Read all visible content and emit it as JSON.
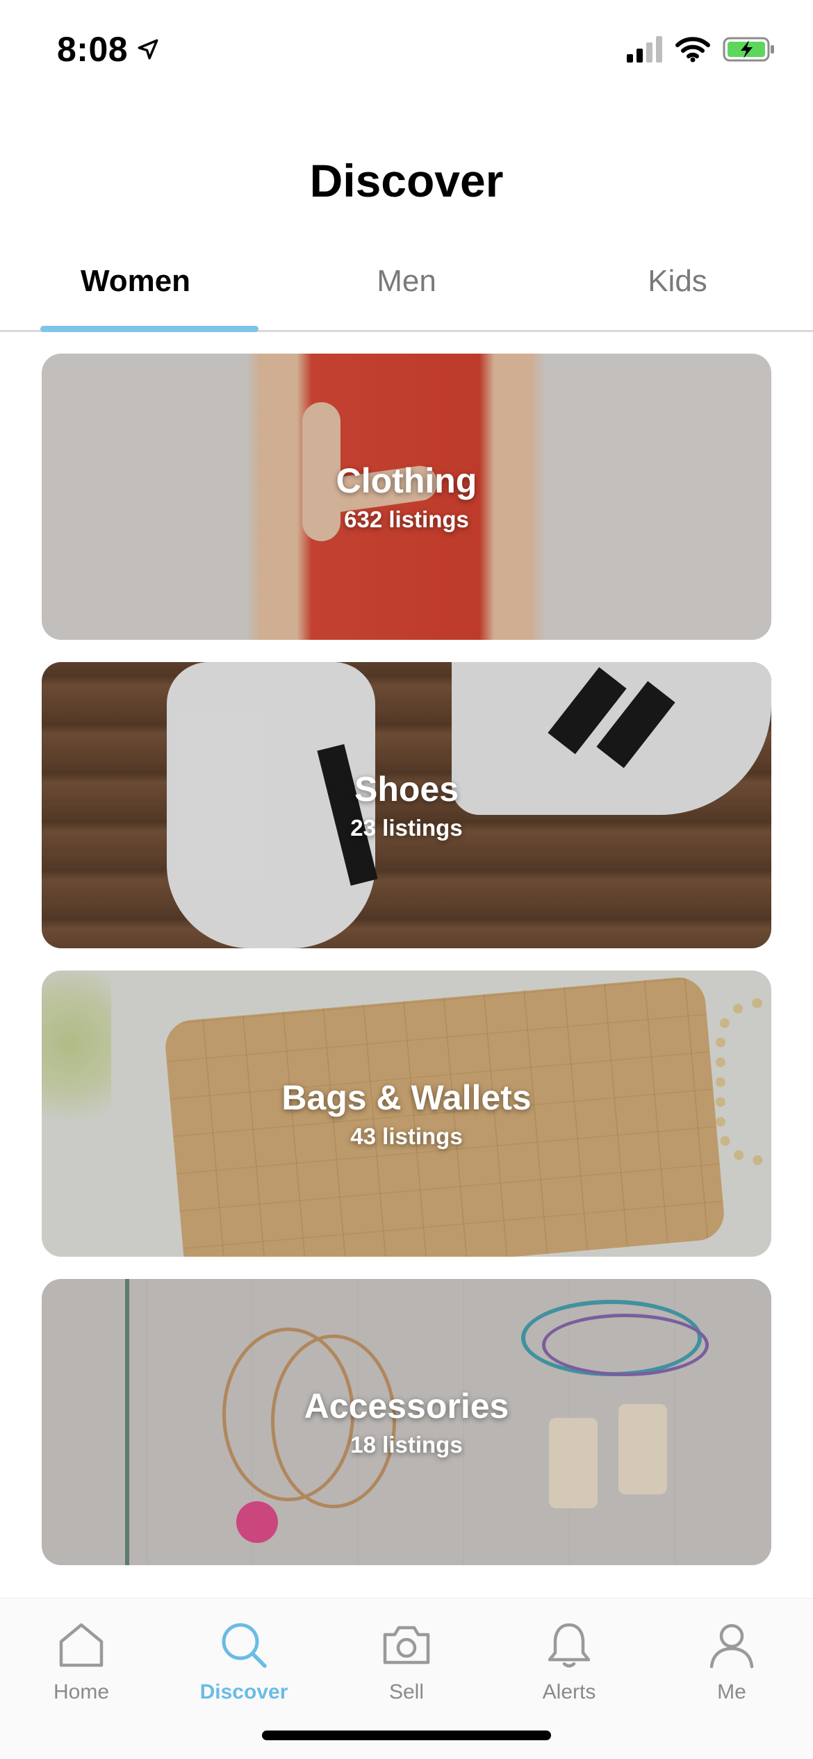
{
  "status_bar": {
    "time": "8:08"
  },
  "header": {
    "title": "Discover"
  },
  "tabs": [
    {
      "label": "Women",
      "active": true
    },
    {
      "label": "Men",
      "active": false
    },
    {
      "label": "Kids",
      "active": false
    }
  ],
  "categories": [
    {
      "title": "Clothing",
      "count": "632 listings",
      "image": "red-floral-dress-photo"
    },
    {
      "title": "Shoes",
      "count": "23 listings",
      "image": "white-sneakers-photo"
    },
    {
      "title": "Bags & Wallets",
      "count": "43 listings",
      "image": "tan-quilted-bag-photo"
    },
    {
      "title": "Accessories",
      "count": "18 listings",
      "image": "jewelry-flatlay-photo"
    }
  ],
  "bottom_nav": [
    {
      "label": "Home",
      "icon": "home-icon",
      "active": false
    },
    {
      "label": "Discover",
      "icon": "search-icon",
      "active": true
    },
    {
      "label": "Sell",
      "icon": "camera-icon",
      "active": false
    },
    {
      "label": "Alerts",
      "icon": "bell-icon",
      "active": false
    },
    {
      "label": "Me",
      "icon": "person-icon",
      "active": false
    }
  ],
  "colors": {
    "accent": "#6bbbe6",
    "tab_indicator": "#7cc4ea",
    "battery_fill": "#5cd65c"
  }
}
